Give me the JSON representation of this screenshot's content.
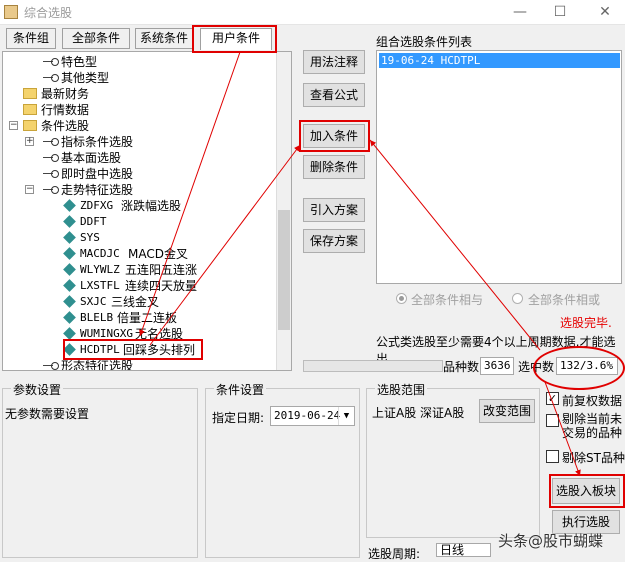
{
  "window": {
    "title": "综合选股",
    "minimize": "—",
    "maximize": "☐",
    "close": "✕"
  },
  "tabs": [
    "条件组",
    "全部条件",
    "系统条件",
    "用户条件"
  ],
  "tree": [
    {
      "label": "特色型",
      "type": "key"
    },
    {
      "label": "其他类型",
      "type": "key"
    },
    {
      "label": "最新财务",
      "type": "folder"
    },
    {
      "label": "行情数据",
      "type": "folder"
    },
    {
      "label": "条件选股",
      "type": "folder",
      "expander": "−"
    },
    {
      "label": "指标条件选股",
      "type": "key",
      "expander": "+"
    },
    {
      "label": "基本面选股",
      "type": "key"
    },
    {
      "label": "即时盘中选股",
      "type": "key"
    },
    {
      "label": "走势特征选股",
      "type": "key",
      "expander": "−"
    },
    {
      "code": "ZDFXG",
      "label": "涨跌幅选股",
      "type": "leaf"
    },
    {
      "code": "DDFT",
      "label": "",
      "type": "leaf"
    },
    {
      "code": "SYS",
      "label": "",
      "type": "leaf"
    },
    {
      "code": "MACDJC",
      "label": "MACD金叉",
      "type": "leaf"
    },
    {
      "code": "WLYWLZ",
      "label": "五连阳五连涨",
      "type": "leaf"
    },
    {
      "code": "LXSTFL",
      "label": "连续四天放量",
      "type": "leaf"
    },
    {
      "code": "SXJC",
      "label": "三线金叉",
      "type": "leaf"
    },
    {
      "code": "BLELB",
      "label": "倍量二连板",
      "type": "leaf"
    },
    {
      "code": "WUMINGXG",
      "label": "无名选股",
      "type": "leaf"
    },
    {
      "code": "HCDTPL",
      "label": "回踩多头排列",
      "type": "leaf"
    },
    {
      "label": "形态特征选股",
      "type": "key"
    }
  ],
  "buttons": {
    "usage_note": "用法注释",
    "view_formula": "查看公式",
    "add_condition": "加入条件",
    "delete_condition": "删除条件",
    "import_plan": "引入方案",
    "save_plan": "保存方案",
    "change_range": "改变范围",
    "select_into_block": "选股入板块",
    "run_selection": "执行选股"
  },
  "condition_list": {
    "label": "组合选股条件列表",
    "items": [
      "19-06-24 HCDTPL"
    ]
  },
  "logic": {
    "and_label": "全部条件相与",
    "or_label": "全部条件相或"
  },
  "status": {
    "done": "选股完毕.",
    "note": "公式类选股至少需要4个以上周期数据,才能选出",
    "stock_count_label": "品种数",
    "stock_count": "3636",
    "hit_label": "选中数",
    "hit_value": "132/3.6%"
  },
  "params": {
    "title": "参数设置",
    "text": "无参数需要设置"
  },
  "condition_settings": {
    "title": "条件设置",
    "date_label": "指定日期:",
    "date_value": "2019-06-24"
  },
  "scope": {
    "title": "选股范围",
    "text": "上证A股 深证A股"
  },
  "options": {
    "forward_adjust": "前复权数据",
    "exclude_untraded": "剔除当前未交易的品种",
    "exclude_st": "剔除ST品种"
  },
  "period": {
    "label": "选股周期:",
    "value": "日线"
  },
  "watermark": "头条@股市蝴蝶",
  "colors": {
    "highlight": "#e00000",
    "selection": "#3399ff"
  }
}
